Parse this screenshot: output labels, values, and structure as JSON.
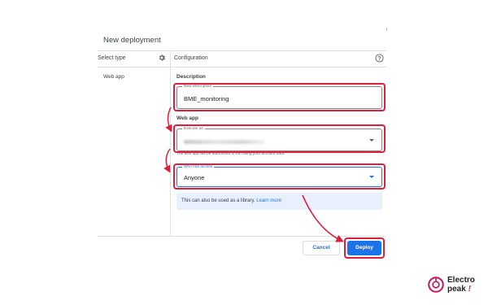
{
  "dialog": {
    "title": "New deployment"
  },
  "left_panel": {
    "header": "Select type",
    "settings_icon": "gear-icon",
    "items": [
      {
        "label": "Web app"
      }
    ]
  },
  "right_panel": {
    "header": "Configuration",
    "help_icon": "help-icon",
    "description_section": {
      "title": "Description",
      "field_label": "New description",
      "value": "BME_monitoring"
    },
    "web_app_section": {
      "title": "Web app",
      "execute_as": {
        "label": "Execute as",
        "value": "Me"
      },
      "execute_hint": "The web app will be authorized to run using your account data.",
      "who_has_access": {
        "label": "Who has access",
        "value": "Anyone"
      }
    },
    "info": {
      "text": "This can also be used as a library.",
      "link": "Learn more"
    }
  },
  "footer": {
    "cancel_label": "Cancel",
    "deploy_label": "Deploy"
  },
  "highlight_color": "#e11d3e",
  "accent_color": "#1a73e8",
  "watermark": {
    "line1": "Electro",
    "line2": "peak",
    "mark": "!"
  }
}
